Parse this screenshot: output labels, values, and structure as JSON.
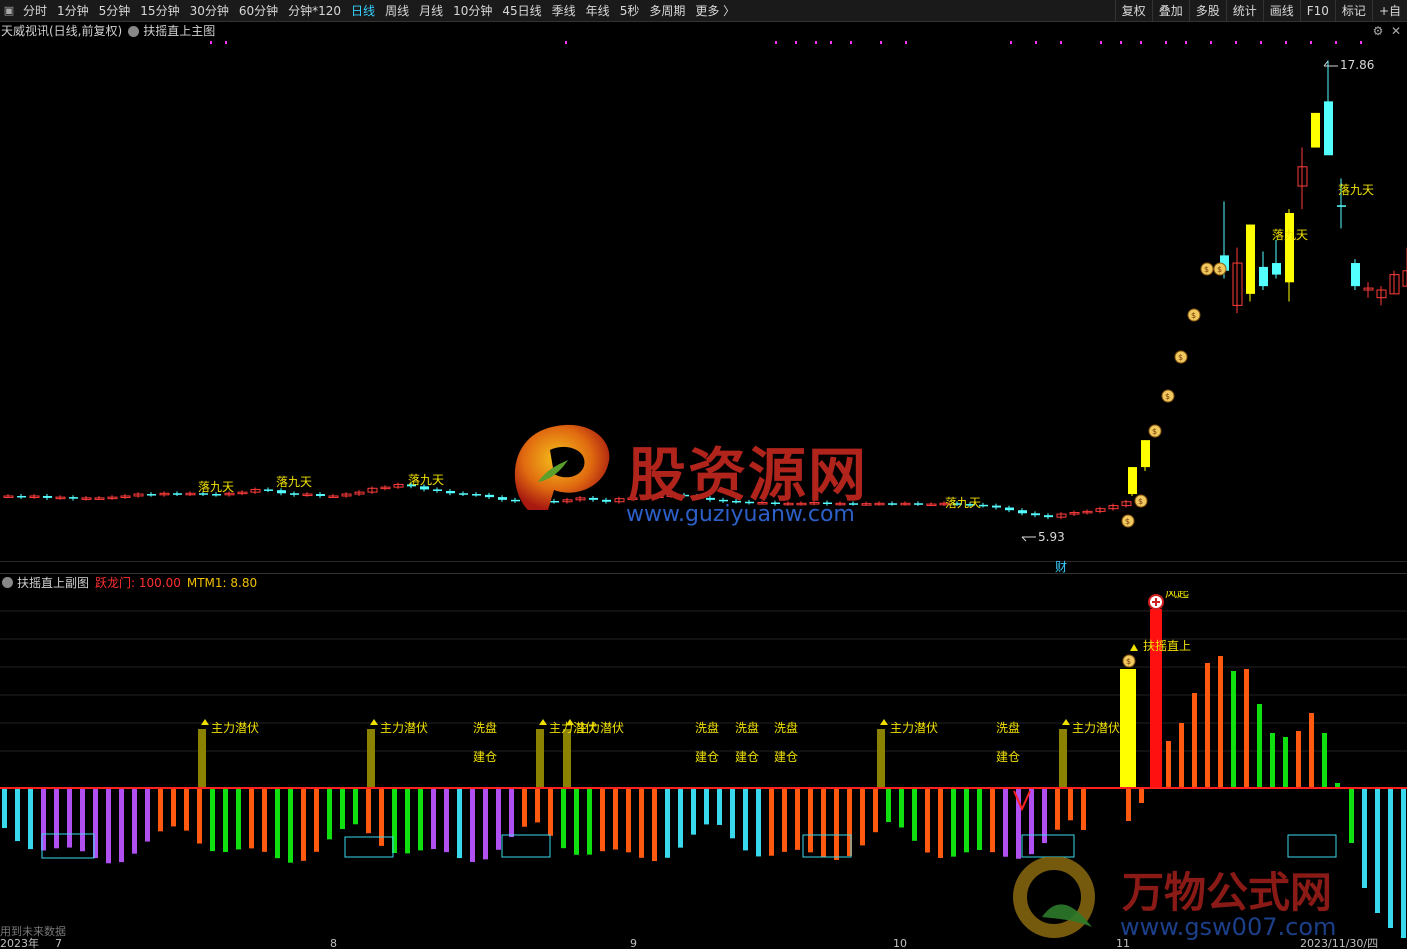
{
  "topbar": {
    "periods": [
      {
        "label": "分时",
        "active": false
      },
      {
        "label": "1分钟",
        "active": false
      },
      {
        "label": "5分钟",
        "active": false
      },
      {
        "label": "15分钟",
        "active": false
      },
      {
        "label": "30分钟",
        "active": false
      },
      {
        "label": "60分钟",
        "active": false
      },
      {
        "label": "分钟*120",
        "active": false
      },
      {
        "label": "日线",
        "active": true
      },
      {
        "label": "周线",
        "active": false
      },
      {
        "label": "月线",
        "active": false
      },
      {
        "label": "10分钟",
        "active": false
      },
      {
        "label": "45日线",
        "active": false
      },
      {
        "label": "季线",
        "active": false
      },
      {
        "label": "年线",
        "active": false
      },
      {
        "label": "5秒",
        "active": false
      },
      {
        "label": "多周期",
        "active": false
      },
      {
        "label": "更多 〉",
        "active": false
      }
    ],
    "tools": [
      "复权",
      "叠加",
      "多股",
      "统计",
      "画线",
      "F10",
      "标记",
      "+自"
    ]
  },
  "main_panel": {
    "stock_label": "天威视讯(日线,前复权)",
    "formula_label": "扶摇直上主图",
    "high_label": "17.86",
    "low_label": "5.93",
    "signal_label": "落九天",
    "finance_marker": "财"
  },
  "sub_panel": {
    "title": "扶摇直上副图",
    "v1_label": "跃龙门: 100.00",
    "v2_label": "MTM1: 8.80",
    "labels": {
      "zhuli": "主力潜伏",
      "xipan": "洗盘",
      "jiancang": "建仓",
      "fuyao": "扶摇直上",
      "qidong": "风起"
    },
    "future_note": "用到未来数据"
  },
  "dates": [
    "2023年",
    "7",
    "8",
    "9",
    "10",
    "11",
    "2023/11/30/四"
  ],
  "watermarks": {
    "wm1_cn": "股资源网",
    "wm1_url": "www.guziyuanw.com",
    "wm2_cn": "万物公式网",
    "wm2_url": "www.gsw007.com"
  },
  "colors": {
    "up": "#ff3c3c",
    "down": "#54ffff",
    "yellow_bar": "#ffff00",
    "label_yellow": "#f0e000",
    "zero_line": "#ff2020",
    "cyan_bar": "#3ad8ec",
    "purple_bar": "#b050f0",
    "orange_bar": "#ff5a10",
    "green_bar": "#10e010",
    "olive_bar": "#8a8200"
  }
}
